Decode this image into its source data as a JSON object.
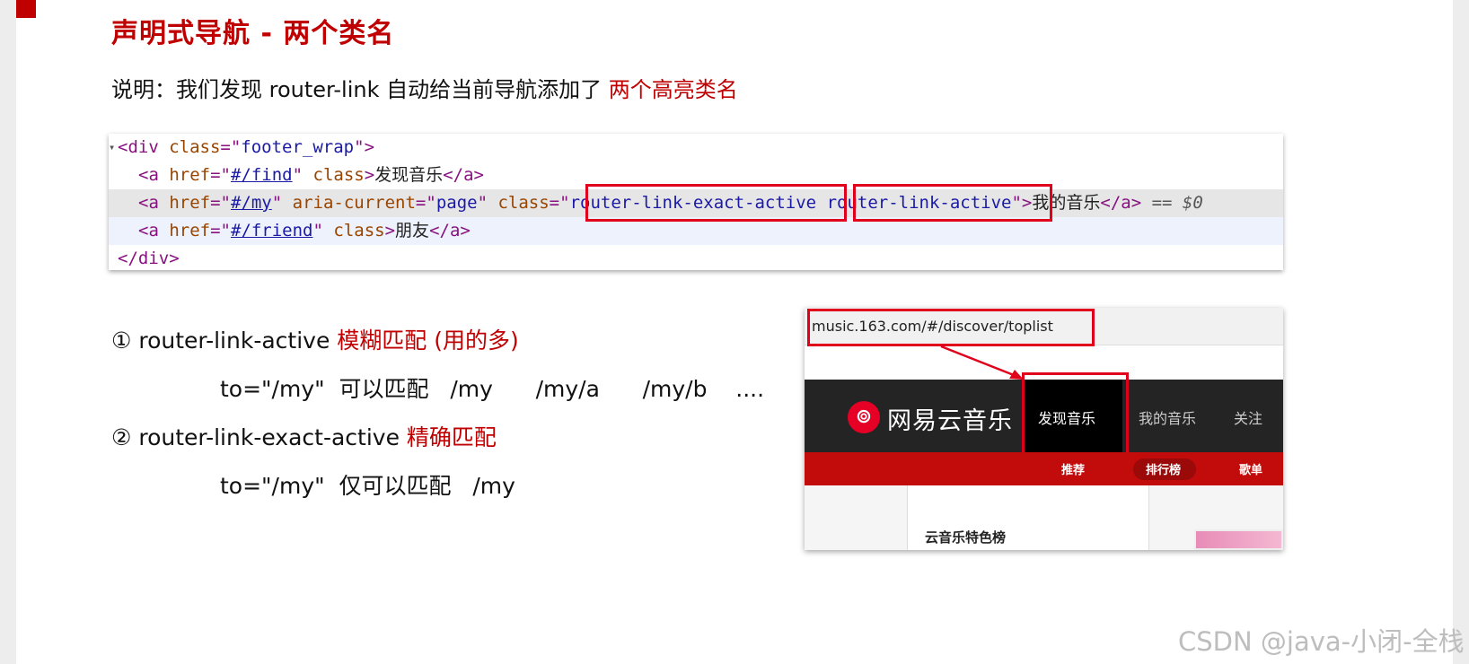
{
  "slide": {
    "title": "声明式导航 - 两个类名",
    "description": {
      "prefix": "说明：我们发现 router-link 自动给当前导航添加了 ",
      "highlight": "两个高亮类名"
    }
  },
  "code": {
    "line1": {
      "open": "<div ",
      "attr": "class",
      "eq": "=\"",
      "val": "footer_wrap",
      "close": "\">"
    },
    "line2": {
      "open": "<a ",
      "href_attr": "href",
      "q1": "=\"",
      "href": "#/find",
      "q2": "\" ",
      "class_attr": "class",
      "gt": ">",
      "text": "发现音乐",
      "end": "</a>"
    },
    "line3": {
      "open": "<a ",
      "href_attr": "href",
      "q1": "=\"",
      "href": "#/my",
      "q2": "\" ",
      "aria_attr": "aria-current",
      "aria_eq": "=\"",
      "aria_val": "page",
      "aria_q": "\" ",
      "class_attr": "class",
      "class_eq": "=\"",
      "class1": "router-link-exact-active",
      "class2": "router-link-active",
      "gt": "\">",
      "text": "我的音乐",
      "end": "</a>",
      "suffix": " == $0"
    },
    "line4": {
      "open": "<a ",
      "href_attr": "href",
      "q1": "=\"",
      "href": "#/friend",
      "q2": "\" ",
      "class_attr": "class",
      "gt": ">",
      "text": "朋友",
      "end": "</a>"
    },
    "line5": {
      "close": "</div>"
    }
  },
  "items": {
    "item1": {
      "label": "① router-link-active ",
      "note": "模糊匹配 (用的多)"
    },
    "item1_example": "to=\"/my\"  可以匹配   /my      /my/a      /my/b    ....",
    "item2": {
      "label": "② router-link-exact-active ",
      "note": "精确匹配"
    },
    "item2_example": "to=\"/my\"  仅可以匹配   /my"
  },
  "music": {
    "url": "music.163.com/#/discover/toplist",
    "logo_text": "网易云音乐",
    "nav": [
      "发现音乐",
      "我的音乐",
      "关注"
    ],
    "subnav": [
      "推荐",
      "排行榜",
      "歌单"
    ],
    "section_title": "云音乐特色榜"
  },
  "watermark": "CSDN @java-小闭-全栈",
  "colors": {
    "accent": "#c00000",
    "box": "#e0001b",
    "nav_bg": "#242424",
    "subnav_bg": "#c20c0c"
  }
}
